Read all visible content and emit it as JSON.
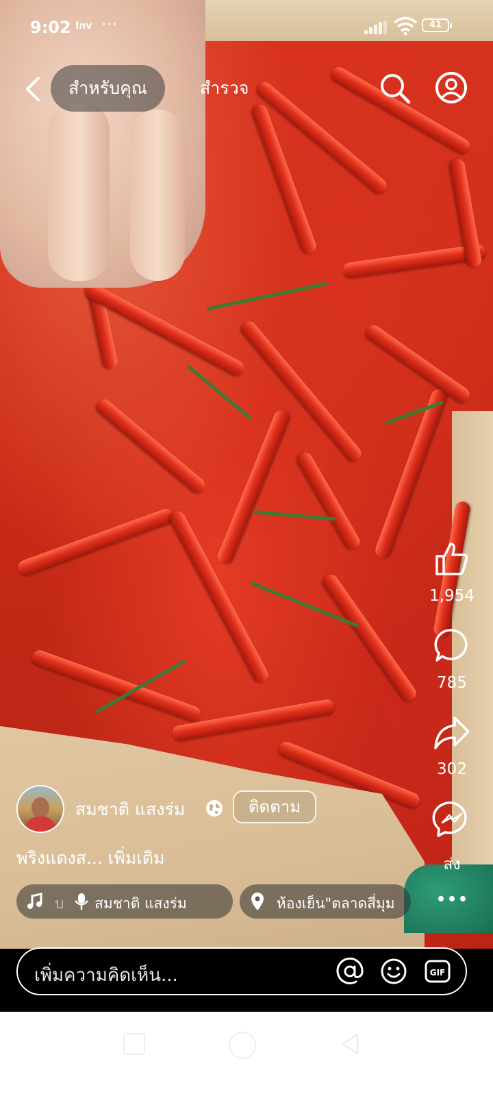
{
  "status_bar": {
    "time": "9:02",
    "carrier_icon_text": "Inv",
    "battery": "41"
  },
  "top_nav": {
    "tab_for_you": "สำหรับคุณ",
    "tab_explore": "สำรวจ"
  },
  "actions": {
    "likes": "1,954",
    "comments": "785",
    "shares": "302",
    "send_label": "ส่ง"
  },
  "author": {
    "name": "สมชาติ แสงร่ม",
    "follow_label": "ติดตาม"
  },
  "caption": "พริงแดงส... เพิ่มเติม",
  "music": {
    "scroll_text": "บ",
    "name": "สมชาติ แสงร่ม"
  },
  "location": {
    "text": "ห้องเย็น\"ตลาดสี่มุม"
  },
  "comment": {
    "placeholder": "เพิ่มความคิดเห็น..."
  },
  "colors": {
    "accent": "#ffffff",
    "background": "#000000"
  }
}
